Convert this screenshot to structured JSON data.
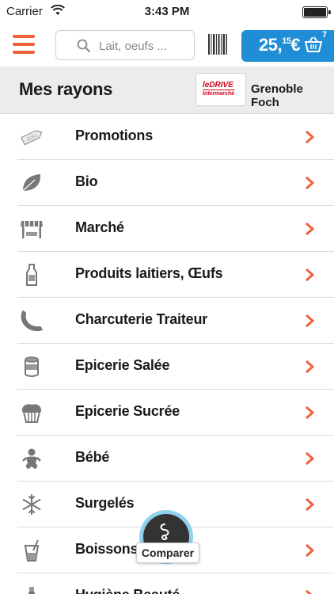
{
  "status_bar": {
    "carrier": "Carrier",
    "time": "3:43 PM"
  },
  "header": {
    "search_placeholder": "Lait, oeufs ...",
    "cart": {
      "amount": "25,",
      "cents": "15",
      "currency": "€",
      "count": "7"
    }
  },
  "section": {
    "title": "Mes rayons",
    "store_logo": {
      "line1": "leDRIVE",
      "line2": "Intermarché"
    },
    "store_name": "Grenoble Foch"
  },
  "categories": [
    {
      "label": "Promotions",
      "icon": "promotion-tag-icon"
    },
    {
      "label": "Bio",
      "icon": "leaf-icon"
    },
    {
      "label": "Marché",
      "icon": "market-stall-icon"
    },
    {
      "label": "Produits laitiers, Œufs",
      "icon": "milk-bottle-icon"
    },
    {
      "label": "Charcuterie Traiteur",
      "icon": "sausage-icon"
    },
    {
      "label": "Epicerie Salée",
      "icon": "can-icon"
    },
    {
      "label": "Epicerie Sucrée",
      "icon": "cupcake-icon"
    },
    {
      "label": "Bébé",
      "icon": "baby-icon"
    },
    {
      "label": "Surgelés",
      "icon": "snowflake-icon"
    },
    {
      "label": "Boissons",
      "icon": "drink-glass-icon"
    },
    {
      "label": "Hygiène Beauté",
      "icon": "beauty-icon"
    }
  ],
  "compare": {
    "label": "Comparer"
  },
  "colors": {
    "accent": "#f0623c",
    "cart_blue": "#1f8ed6",
    "header_gray": "#ececec"
  }
}
